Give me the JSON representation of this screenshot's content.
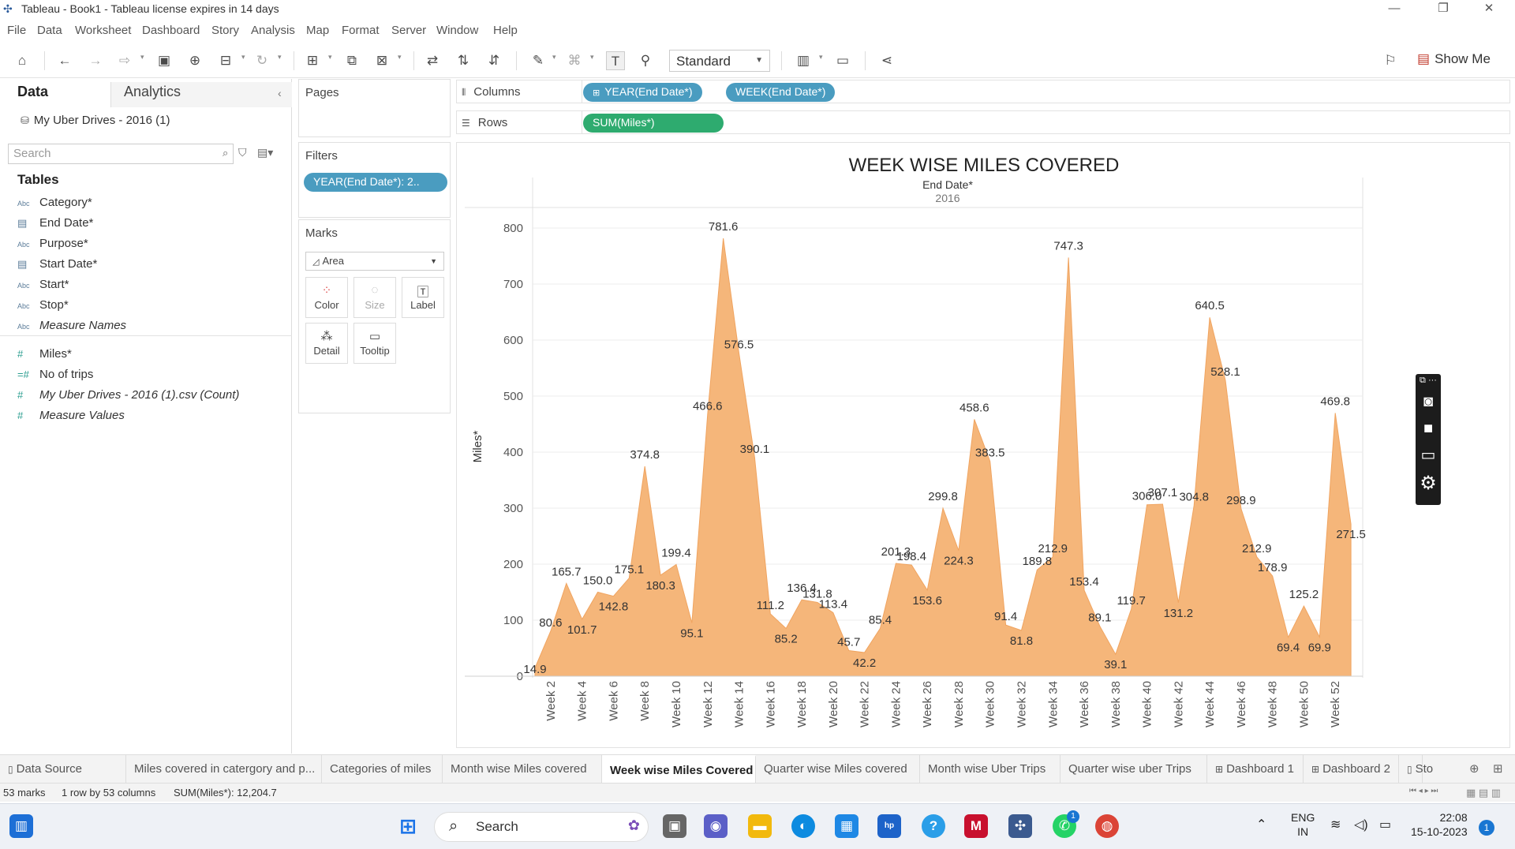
{
  "window": {
    "title": "Tableau - Book1 - Tableau license expires in 14 days"
  },
  "menu": [
    "File",
    "Data",
    "Worksheet",
    "Dashboard",
    "Story",
    "Analysis",
    "Map",
    "Format",
    "Server",
    "Window",
    "Help"
  ],
  "toolbar": {
    "fit_mode": "Standard",
    "show_me": "Show Me"
  },
  "data_pane": {
    "tab_data": "Data",
    "tab_analytics": "Analytics",
    "datasource": "My Uber Drives - 2016 (1)",
    "search_placeholder": "Search",
    "tables_header": "Tables",
    "dimensions": [
      {
        "type": "Abc",
        "name": "Category*"
      },
      {
        "type": "date",
        "name": "End Date*"
      },
      {
        "type": "Abc",
        "name": "Purpose*"
      },
      {
        "type": "date",
        "name": "Start Date*"
      },
      {
        "type": "Abc",
        "name": "Start*"
      },
      {
        "type": "Abc",
        "name": "Stop*"
      },
      {
        "type": "Abc",
        "name": "Measure Names"
      }
    ],
    "measures": [
      {
        "type": "#",
        "name": "Miles*"
      },
      {
        "type": "calc",
        "name": "No of trips"
      },
      {
        "type": "#",
        "name": "My Uber Drives - 2016 (1).csv (Count)"
      },
      {
        "type": "#",
        "name": "Measure Values"
      }
    ]
  },
  "cards": {
    "pages": "Pages",
    "filters": "Filters",
    "filter_pill": "YEAR(End Date*): 2..",
    "marks": "Marks",
    "mark_type": "Area",
    "mark_buttons": [
      "Color",
      "Size",
      "Label",
      "Detail",
      "Tooltip"
    ]
  },
  "shelves": {
    "columns_label": "Columns",
    "rows_label": "Rows",
    "columns_pills": [
      "YEAR(End Date*)",
      "WEEK(End Date*)"
    ],
    "rows_pills": [
      "SUM(Miles*)"
    ]
  },
  "chart_data": {
    "type": "area",
    "title": "WEEK WISE MILES COVERED",
    "header_field": "End Date*",
    "header_value": "2016",
    "ylabel": "Miles*",
    "ylim": [
      0,
      800
    ],
    "yticks": [
      0,
      100,
      200,
      300,
      400,
      500,
      600,
      700,
      800
    ],
    "x": [
      "Week 1",
      "Week 2",
      "Week 3",
      "Week 4",
      "Week 5",
      "Week 6",
      "Week 7",
      "Week 8",
      "Week 9",
      "Week 10",
      "Week 11",
      "Week 12",
      "Week 13",
      "Week 14",
      "Week 15",
      "Week 16",
      "Week 17",
      "Week 18",
      "Week 19",
      "Week 20",
      "Week 21",
      "Week 22",
      "Week 23",
      "Week 24",
      "Week 25",
      "Week 26",
      "Week 27",
      "Week 28",
      "Week 29",
      "Week 30",
      "Week 31",
      "Week 32",
      "Week 33",
      "Week 34",
      "Week 35",
      "Week 36",
      "Week 37",
      "Week 38",
      "Week 39",
      "Week 40",
      "Week 41",
      "Week 42",
      "Week 43",
      "Week 44",
      "Week 45",
      "Week 46",
      "Week 47",
      "Week 48",
      "Week 49",
      "Week 50",
      "Week 51",
      "Week 52",
      "Week 53"
    ],
    "x_tick_labels": [
      "Week 2",
      "Week 4",
      "Week 6",
      "Week 8",
      "Week 10",
      "Week 12",
      "Week 14",
      "Week 16",
      "Week 18",
      "Week 20",
      "Week 22",
      "Week 24",
      "Week 26",
      "Week 28",
      "Week 30",
      "Week 32",
      "Week 34",
      "Week 36",
      "Week 38",
      "Week 40",
      "Week 42",
      "Week 44",
      "Week 46",
      "Week 48",
      "Week 50",
      "Week 52"
    ],
    "values": [
      14.9,
      80.6,
      165.7,
      101.7,
      150.0,
      142.8,
      175.1,
      374.8,
      180.3,
      199.4,
      95.1,
      466.6,
      781.6,
      576.5,
      390.1,
      111.2,
      85.2,
      136.4,
      131.8,
      113.4,
      45.7,
      42.2,
      85.4,
      201.3,
      198.4,
      153.6,
      299.8,
      224.3,
      458.6,
      383.5,
      91.4,
      81.8,
      189.8,
      212.9,
      747.3,
      153.4,
      89.1,
      39.1,
      119.7,
      306.0,
      307.1,
      131.2,
      304.8,
      640.5,
      528.1,
      298.9,
      212.9,
      178.9,
      69.4,
      125.2,
      69.9,
      469.8,
      271.5
    ],
    "data_labels": [
      "14.9",
      "80.6",
      "165.7",
      "101.7",
      "150.0",
      "142.8",
      "175.1",
      "374.8",
      "180.3",
      "199.4",
      "95.1",
      "466.6",
      "781.6",
      "576.5",
      "390.1",
      "111.2",
      "85.2",
      "136.4",
      "131.8",
      "113.4",
      "45.7",
      "42.2",
      "85.4",
      "201.3",
      "198.4",
      "153.6",
      "299.8",
      "224.3",
      "458.6",
      "383.5",
      "91.4",
      "81.8",
      "189.8",
      "212.9",
      "747.3",
      "153.4",
      "89.1",
      "39.1",
      "119.7",
      "306.0",
      "307.1",
      "131.2",
      "304.8",
      "640.5",
      "528.1",
      "298.9",
      "212.9",
      "178.9",
      "69.4",
      "125.2",
      "69.9",
      "469.8",
      "271.5"
    ],
    "fill_color": "#f5b67a",
    "grid": true
  },
  "sheet_tabs": [
    {
      "label": "Data Source",
      "icon": "db"
    },
    {
      "label": "Miles covered in catergory and p...",
      "icon": ""
    },
    {
      "label": "Categories of miles",
      "icon": ""
    },
    {
      "label": "Month wise Miles covered",
      "icon": ""
    },
    {
      "label": "Week wise Miles Covered",
      "icon": "",
      "active": true
    },
    {
      "label": "Quarter wise Miles covered",
      "icon": ""
    },
    {
      "label": "Month wise Uber Trips",
      "icon": ""
    },
    {
      "label": "Quarter wise uber Trips",
      "icon": ""
    },
    {
      "label": "Dashboard 1",
      "icon": "dash"
    },
    {
      "label": "Dashboard 2",
      "icon": "dash"
    },
    {
      "label": "Sto",
      "icon": "story"
    }
  ],
  "status": {
    "marks": "53 marks",
    "rows_cols": "1 row by 53 columns",
    "sum": "SUM(Miles*): 12,204.7"
  },
  "taskbar": {
    "search": "Search",
    "lang1": "ENG",
    "lang2": "IN",
    "time": "22:08",
    "date": "15-10-2023",
    "notif": "1",
    "whatsapp_badge": "1"
  }
}
